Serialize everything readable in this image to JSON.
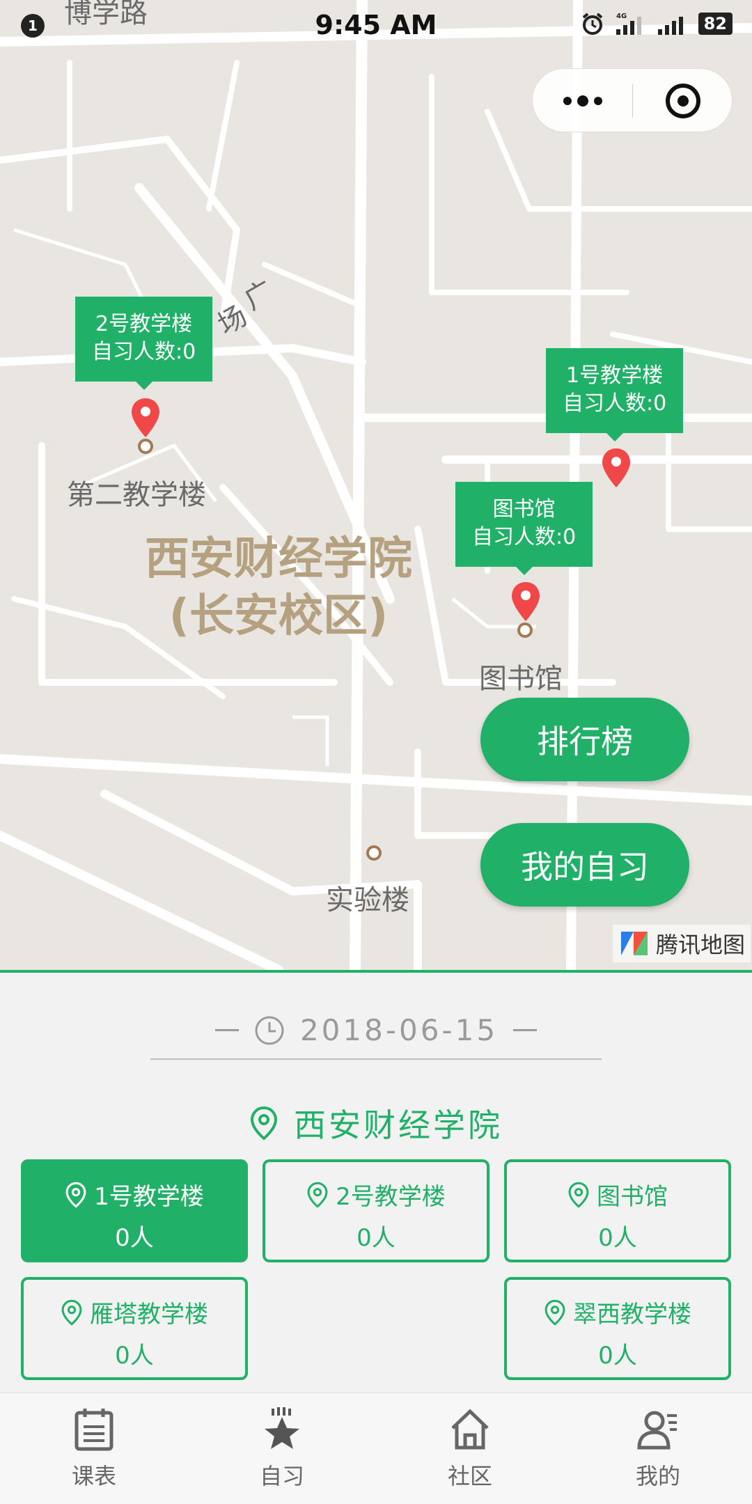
{
  "status_bar": {
    "notification_count": "1",
    "time": "9:45 AM",
    "network": "4G",
    "battery": "82"
  },
  "map": {
    "labels": {
      "road": "博学路",
      "plaza_a": "广",
      "plaza_b": "场",
      "second_building": "第二教学楼",
      "campus_line1": "西安财经学院",
      "campus_line2": "(长安校区)",
      "library": "图书馆",
      "lab": "实验楼"
    },
    "callouts": [
      {
        "name": "2号教学楼",
        "count": "自习人数:0"
      },
      {
        "name": "1号教学楼",
        "count": "自习人数:0"
      },
      {
        "name": "图书馆",
        "count": "自习人数:0"
      }
    ],
    "buttons": {
      "ranking": "排行榜",
      "my_study": "我的自习"
    },
    "brand": "腾讯地图"
  },
  "date": "2018-06-15",
  "school": "西安财经学院",
  "buildings": [
    {
      "name": "1号教学楼",
      "count": "0人",
      "selected": true
    },
    {
      "name": "2号教学楼",
      "count": "0人",
      "selected": false
    },
    {
      "name": "图书馆",
      "count": "0人",
      "selected": false
    },
    {
      "name": "雁塔教学楼",
      "count": "0人",
      "selected": false
    },
    {
      "name": "翠西教学楼",
      "count": "0人",
      "selected": false
    }
  ],
  "tabs": [
    {
      "label": "课表",
      "icon": "schedule-icon"
    },
    {
      "label": "自习",
      "icon": "star-icon"
    },
    {
      "label": "社区",
      "icon": "home-icon"
    },
    {
      "label": "我的",
      "icon": "profile-icon"
    }
  ],
  "colors": {
    "accent": "#21b068",
    "map_bg": "#e9e6e1",
    "pin": "#f04848"
  }
}
